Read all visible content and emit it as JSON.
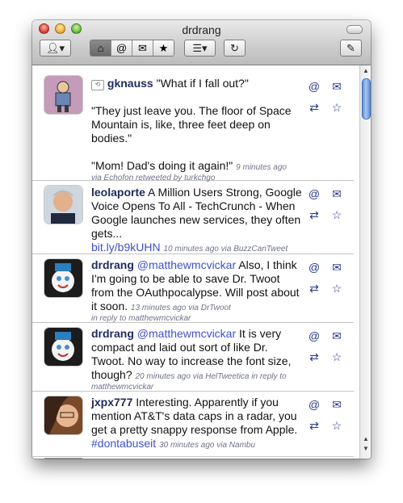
{
  "window": {
    "title": "drdrang"
  },
  "toolbar": {
    "account_icon": "person-icon",
    "tabs": [
      "home-icon",
      "at-mentions-icon",
      "messages-icon",
      "favorites-icon"
    ],
    "list_icon": "list-icon",
    "refresh_icon": "refresh-icon",
    "compose_icon": "compose-icon"
  },
  "tweets": [
    {
      "user": "gknauss",
      "retweet_badge": true,
      "text": " \"What if I fall out?\"",
      "text2": "\"They just leave you. The floor of Space Mountain is, like, three feet deep on bodies.\"",
      "text3": "\"Mom! Dad's doing it again!\"",
      "time": "9 minutes ago",
      "source": "via Echofon retweeted by turkchgo"
    },
    {
      "user": "leolaporte",
      "text": " A Million Users Strong, Google Voice Opens To All - TechCrunch - When Google launches new services, they often gets...",
      "link": "bit.ly/b9kUHN",
      "time": "10 minutes ago via BuzzCanTweet"
    },
    {
      "user": "drdrang",
      "mention": "@matthewmcvickar",
      "text": " Also, I think I'm going to be able to save Dr. Twoot from the OAuthpocalypse. Will post about it soon.",
      "time": "13 minutes ago via DrTwoot",
      "reply": "in reply to matthewmcvickar"
    },
    {
      "user": "drdrang",
      "mention": "@matthewmcvickar",
      "text": " It is very compact and laid out sort of like Dr. Twoot. No way to increase the font size, though?",
      "time": "20 minutes ago via HelTweetica in reply to",
      "reply": "matthewmcvickar"
    },
    {
      "user": "jxpx777",
      "text": " Interesting. Apparently if you mention AT&T's data caps in a radar, you get a pretty snappy response from Apple.",
      "hashtag": "#dontabuseit",
      "time": "30 minutes ago via Nambu"
    }
  ],
  "action_icons": [
    "reply-icon",
    "direct-message-icon",
    "retweet-icon",
    "favorite-star-icon"
  ]
}
